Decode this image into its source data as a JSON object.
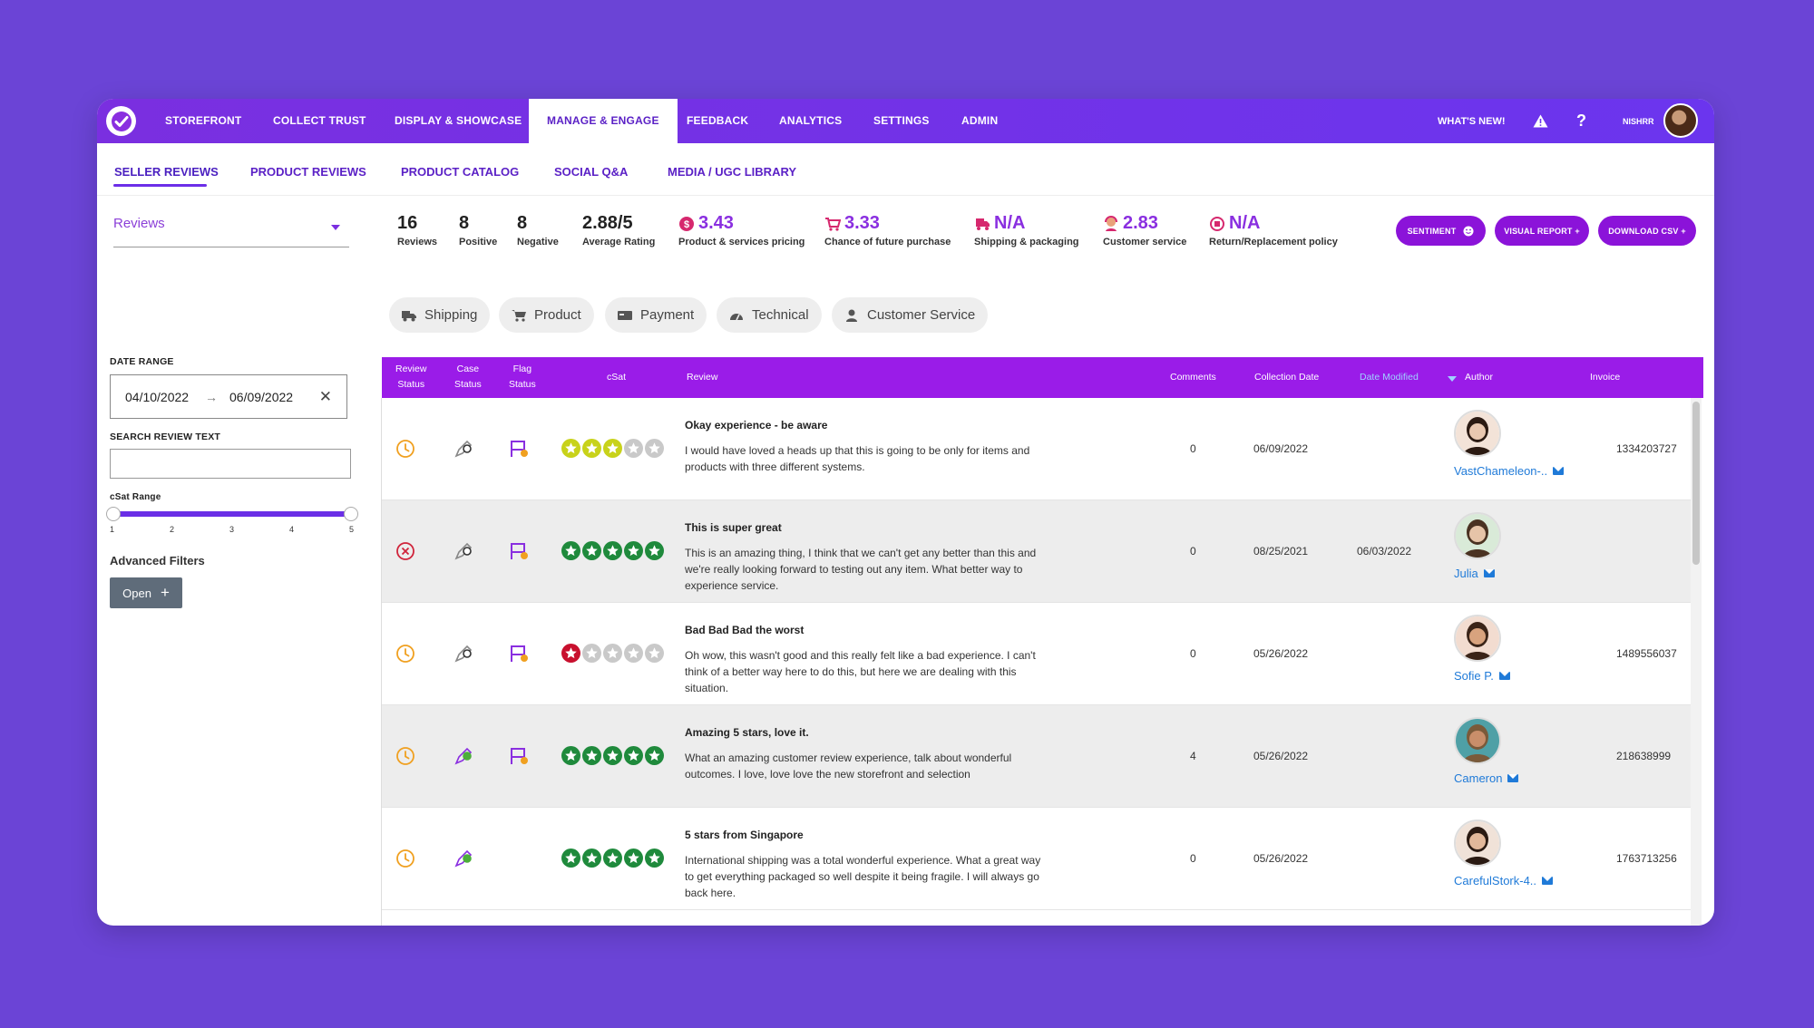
{
  "nav": {
    "items": [
      "STOREFRONT",
      "COLLECT TRUST",
      "DISPLAY & SHOWCASE",
      "MANAGE & ENGAGE",
      "FEEDBACK",
      "ANALYTICS",
      "SETTINGS",
      "ADMIN"
    ],
    "active": "MANAGE & ENGAGE",
    "whats_new": "WHAT'S NEW!",
    "help": "?",
    "username": "NISHRR"
  },
  "subnav": {
    "items": [
      "SELLER REVIEWS",
      "PRODUCT REVIEWS",
      "PRODUCT CATALOG",
      "SOCIAL Q&A",
      "MEDIA / UGC LIBRARY"
    ],
    "active": "SELLER REVIEWS"
  },
  "sidebar": {
    "select_value": "Reviews",
    "date_range_label": "DATE RANGE",
    "date_start": "04/10/2022",
    "date_arrow": "→",
    "date_end": "06/09/2022",
    "clear_symbol": "✕",
    "search_label": "SEARCH REVIEW TEXT",
    "search_value": "",
    "csat_label": "cSat Range",
    "csat_min": 1,
    "csat_max": 5,
    "ticks": [
      "1",
      "2",
      "3",
      "4",
      "5"
    ],
    "advanced_filters": "Advanced Filters",
    "open_button": "Open",
    "open_plus": "+"
  },
  "stats": [
    {
      "value": "16",
      "label": "Reviews"
    },
    {
      "value": "8",
      "label": "Positive"
    },
    {
      "value": "8",
      "label": "Negative"
    },
    {
      "value": "2.88/5",
      "label": "Average Rating"
    },
    {
      "value": "3.43",
      "label": "Product & services pricing",
      "icon": "dollar-icon"
    },
    {
      "value": "3.33",
      "label": "Chance of future purchase",
      "icon": "cart-icon"
    },
    {
      "value": "N/A",
      "label": "Shipping & packaging",
      "icon": "delivery-icon"
    },
    {
      "value": "2.83",
      "label": "Customer service",
      "icon": "agent-icon"
    },
    {
      "value": "N/A",
      "label": "Return/Replacement policy",
      "icon": "return-icon"
    }
  ],
  "actions": {
    "sentiment": "SENTIMENT",
    "visual_report": "VISUAL REPORT +",
    "download_csv": "DOWNLOAD CSV +"
  },
  "chips": [
    {
      "label": "Shipping",
      "icon": "truck-icon"
    },
    {
      "label": "Product",
      "icon": "cart-icon"
    },
    {
      "label": "Payment",
      "icon": "payment-card-icon"
    },
    {
      "label": "Technical",
      "icon": "gauge-icon"
    },
    {
      "label": "Customer Service",
      "icon": "person-icon"
    }
  ],
  "table": {
    "headers": {
      "review_status_1": "Review",
      "review_status_2": "Status",
      "case_status_1": "Case",
      "case_status_2": "Status",
      "flag_status_1": "Flag",
      "flag_status_2": "Status",
      "csat": "cSat",
      "review": "Review",
      "comments": "Comments",
      "collection_date": "Collection Date",
      "date_modified": "Date Modified",
      "author": "Author",
      "invoice": "Invoice"
    },
    "rows": [
      {
        "status": "pending",
        "case": "open",
        "flag": true,
        "rating": 3,
        "title": "Okay experience - be aware",
        "body": "I would have loved a heads up that this is going to be only for items and products with three different systems.",
        "comments": "0",
        "collection_date": "06/09/2022",
        "date_modified": "",
        "author": "VastChameleon-..",
        "invoice": "1334203727"
      },
      {
        "status": "rejected",
        "case": "open",
        "flag": true,
        "rating": 5,
        "title": "This is super great",
        "body": "This is an amazing thing, I think that we can't get any better than this and we're really looking forward to testing out any item. What better way to experience service.",
        "comments": "0",
        "collection_date": "08/25/2021",
        "date_modified": "06/03/2022",
        "author": "Julia",
        "invoice": ""
      },
      {
        "status": "pending",
        "case": "open",
        "flag": true,
        "rating": 1,
        "title": "Bad Bad Bad the worst",
        "body": "Oh wow, this wasn't good and this really felt like a bad experience. I can't think of a better way here to do this, but here we are dealing with this situation.",
        "comments": "0",
        "collection_date": "05/26/2022",
        "date_modified": "",
        "author": "Sofie P.",
        "invoice": "1489556037"
      },
      {
        "status": "pending",
        "case": "resolved",
        "flag": true,
        "rating": 5,
        "title": "Amazing 5 stars, love it.",
        "body": "What an amazing customer review experience, talk about wonderful outcomes. I love, love love the new storefront and selection",
        "comments": "4",
        "collection_date": "05/26/2022",
        "date_modified": "",
        "author": "Cameron",
        "invoice": "218638999"
      },
      {
        "status": "pending",
        "case": "resolved",
        "flag": false,
        "rating": 5,
        "title": "5 stars from Singapore",
        "body": "International shipping was a total wonderful experience. What a great way to get everything packaged so well despite it being fragile. I will always go back here.",
        "comments": "0",
        "collection_date": "05/26/2022",
        "date_modified": "",
        "author": "CarefulStork-4..",
        "invoice": "1763713256"
      }
    ]
  },
  "colors": {
    "brand": "#7a2fe0",
    "header": "#9a1ce8",
    "star_green": "#1f8a3c",
    "star_yellow": "#c8d21a",
    "star_red": "#c8102e",
    "star_empty": "#c9c9c9",
    "status_pending": "#f0a020",
    "status_rejected": "#d0243b",
    "link": "#1f7ad8"
  }
}
